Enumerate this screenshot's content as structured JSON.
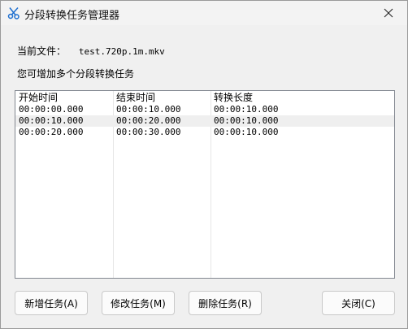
{
  "window": {
    "title": "分段转换任务管理器"
  },
  "file_info": {
    "label": "当前文件：",
    "filename": "test.720p.1m.mkv"
  },
  "hint": "您可增加多个分段转换任务",
  "table": {
    "columns": [
      "开始时间",
      "结束时间",
      "转换长度"
    ],
    "rows": [
      [
        "00:00:00.000",
        "00:00:10.000",
        "00:00:10.000"
      ],
      [
        "00:00:10.000",
        "00:00:20.000",
        "00:00:10.000"
      ],
      [
        "00:00:20.000",
        "00:00:30.000",
        "00:00:10.000"
      ]
    ],
    "selected_row": 1
  },
  "buttons": {
    "add": "新增任务(A)",
    "edit": "修改任务(M)",
    "delete": "删除任务(R)",
    "close": "关闭(C)"
  },
  "icons": {
    "app": "scissors-icon",
    "close": "close-icon"
  },
  "colors": {
    "dialog_bg": "#f0f0f0",
    "list_bg": "#ffffff",
    "selected_row": "#efefef",
    "icon_blue": "#1e6fd0"
  }
}
